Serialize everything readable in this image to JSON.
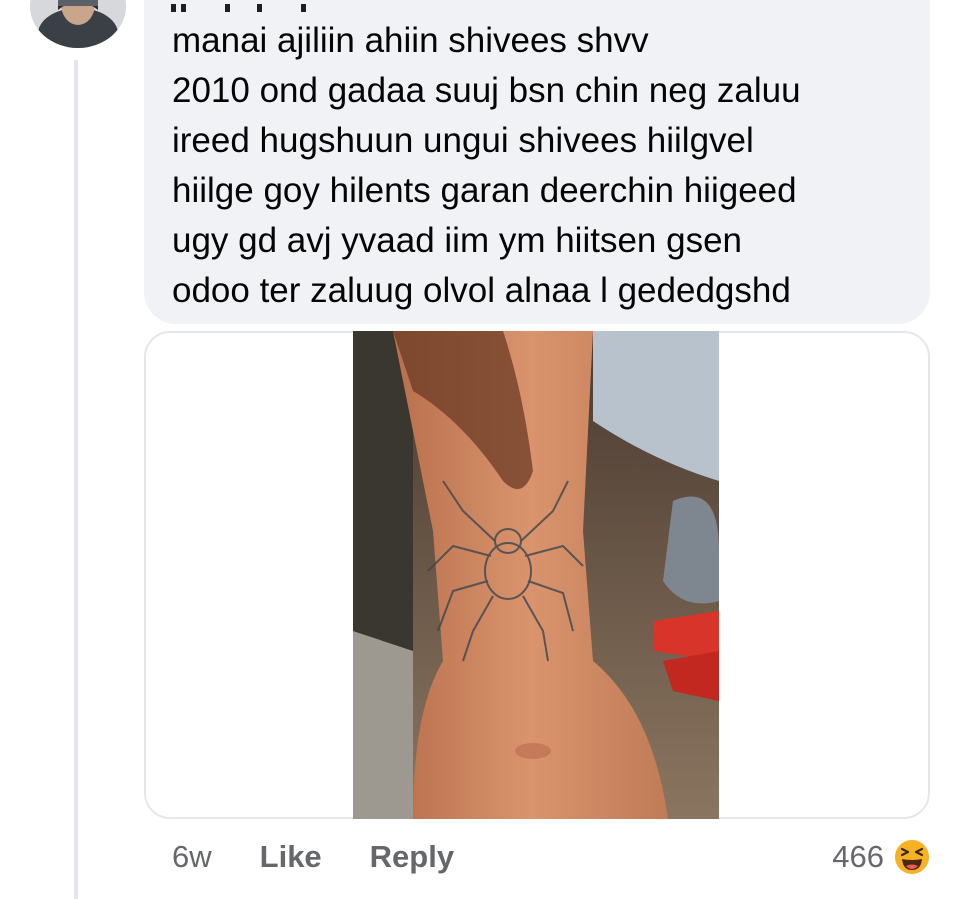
{
  "comment": {
    "text": "manai ajiliin ahiin shivees shvv\n2010 ond gadaa suuj bsn chin neg zaluu\nireed hugshuun ungui shivees hiilgvel\nhiilge goy hilents garan deerchin hiigeed\nugy gd avj yvaad iim ym hiitsen gsen\nodoo ter zaluug olvol alnaa l gededgshd",
    "attachment_icon": "photo-of-spider-tattoo-on-wrist"
  },
  "actions": {
    "time": "6w",
    "like_label": "Like",
    "reply_label": "Reply"
  },
  "reactions": {
    "count": "466",
    "icon": "haha-emoji-icon"
  },
  "colors": {
    "bubble": "#f0f2f5",
    "text": "#050505",
    "meta": "#65676b",
    "thread_line": "#e4e6eb",
    "haha": "#f7b125"
  }
}
